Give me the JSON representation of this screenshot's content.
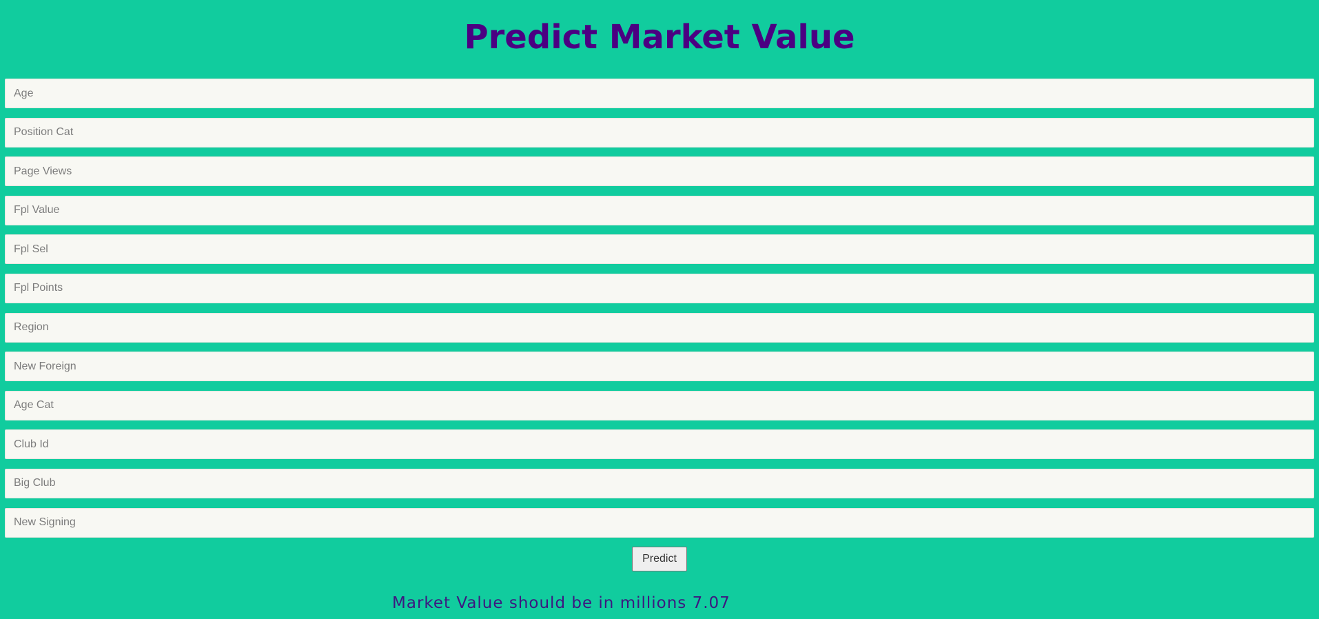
{
  "title": "Predict Market Value",
  "colors": {
    "background": "#11cc9e",
    "title": "#4b0082",
    "field_background": "#f8f8f3",
    "result_text": "#3d1880"
  },
  "form": {
    "fields": [
      {
        "placeholder": "Age",
        "value": ""
      },
      {
        "placeholder": "Position Cat",
        "value": ""
      },
      {
        "placeholder": "Page Views",
        "value": ""
      },
      {
        "placeholder": "Fpl Value",
        "value": ""
      },
      {
        "placeholder": "Fpl Sel",
        "value": ""
      },
      {
        "placeholder": "Fpl Points",
        "value": ""
      },
      {
        "placeholder": "Region",
        "value": ""
      },
      {
        "placeholder": "New Foreign",
        "value": ""
      },
      {
        "placeholder": "Age Cat",
        "value": ""
      },
      {
        "placeholder": "Club Id",
        "value": ""
      },
      {
        "placeholder": "Big Club",
        "value": ""
      },
      {
        "placeholder": "New Signing",
        "value": ""
      }
    ],
    "submit_label": "Predict"
  },
  "result": "Market Value should be in millions 7.07"
}
